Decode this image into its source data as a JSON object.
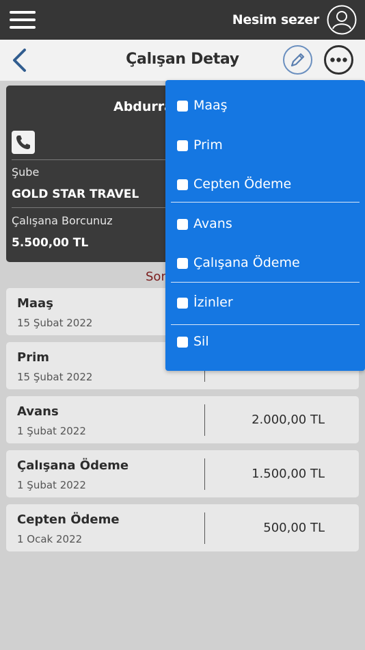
{
  "topbar": {
    "user_name": "Nesim sezer"
  },
  "header": {
    "title": "Çalışan Detay"
  },
  "card": {
    "name": "Abdurra",
    "branch_label": "Şube",
    "branch_value": "GOLD STAR TRAVEL",
    "debt_label": "Çalışana Borcunuz",
    "debt_value": "5.500,00 TL"
  },
  "section": {
    "title": "Son"
  },
  "transactions": [
    {
      "name": "Maaş",
      "date": "15 Şubat 2022",
      "amount": ""
    },
    {
      "name": "Prim",
      "date": "15 Şubat 2022",
      "amount": ""
    },
    {
      "name": "Avans",
      "date": "1 Şubat 2022",
      "amount": "2.000,00 TL"
    },
    {
      "name": "Çalışana Ödeme",
      "date": "1 Şubat 2022",
      "amount": "1.500,00 TL"
    },
    {
      "name": "Cepten Ödeme",
      "date": "1 Ocak 2022",
      "amount": "500,00 TL"
    }
  ],
  "dropdown": {
    "items": [
      {
        "label": "Maaş"
      },
      {
        "label": "Prim"
      },
      {
        "label": "Cepten Ödeme"
      },
      {
        "label": "Avans"
      },
      {
        "label": "Çalışana Ödeme"
      },
      {
        "label": "İzinler"
      },
      {
        "label": "Sil"
      }
    ]
  },
  "colors": {
    "accent": "#1577e2",
    "topbar": "#363636",
    "card": "#3a3a3a"
  },
  "icons": [
    "hamburger-icon",
    "user-icon",
    "back-icon",
    "pencil-icon",
    "more-icon",
    "phone-icon"
  ]
}
